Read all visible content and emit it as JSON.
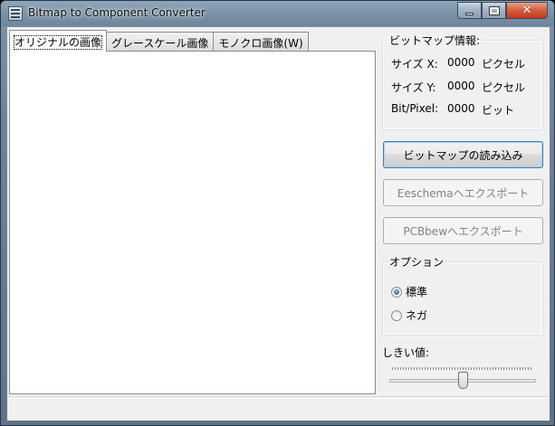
{
  "window": {
    "title": "Bitmap to Component Converter"
  },
  "tabs": [
    {
      "label": "オリジナルの画像",
      "active": true
    },
    {
      "label": "グレースケール画像",
      "active": false
    },
    {
      "label": "モノクロ画像(W)",
      "active": false
    }
  ],
  "bitmap_info": {
    "title": "ビットマップ情報:",
    "rows": [
      {
        "label": "サイズ X:",
        "value": "0000",
        "unit": "ピクセル"
      },
      {
        "label": "サイズ Y:",
        "value": "0000",
        "unit": "ピクセル"
      },
      {
        "label": "Bit/Pixel:",
        "value": "0000",
        "unit": "ビット"
      }
    ]
  },
  "buttons": {
    "load_bitmap": "ビットマップの読み込み",
    "export_eeschema": "Eeschemaへエクスポート",
    "export_pcbnew": "PCBbewへエクスポート"
  },
  "options": {
    "title": "オプション",
    "radios": [
      {
        "label": "標準",
        "checked": true
      },
      {
        "label": "ネガ",
        "checked": false
      }
    ]
  },
  "threshold": {
    "label": "しきい値:",
    "value_fraction": 0.5
  },
  "colors": {
    "titlebar": "#7a91a7",
    "close_button": "#c2391b",
    "panel": "#f0f0f0"
  }
}
